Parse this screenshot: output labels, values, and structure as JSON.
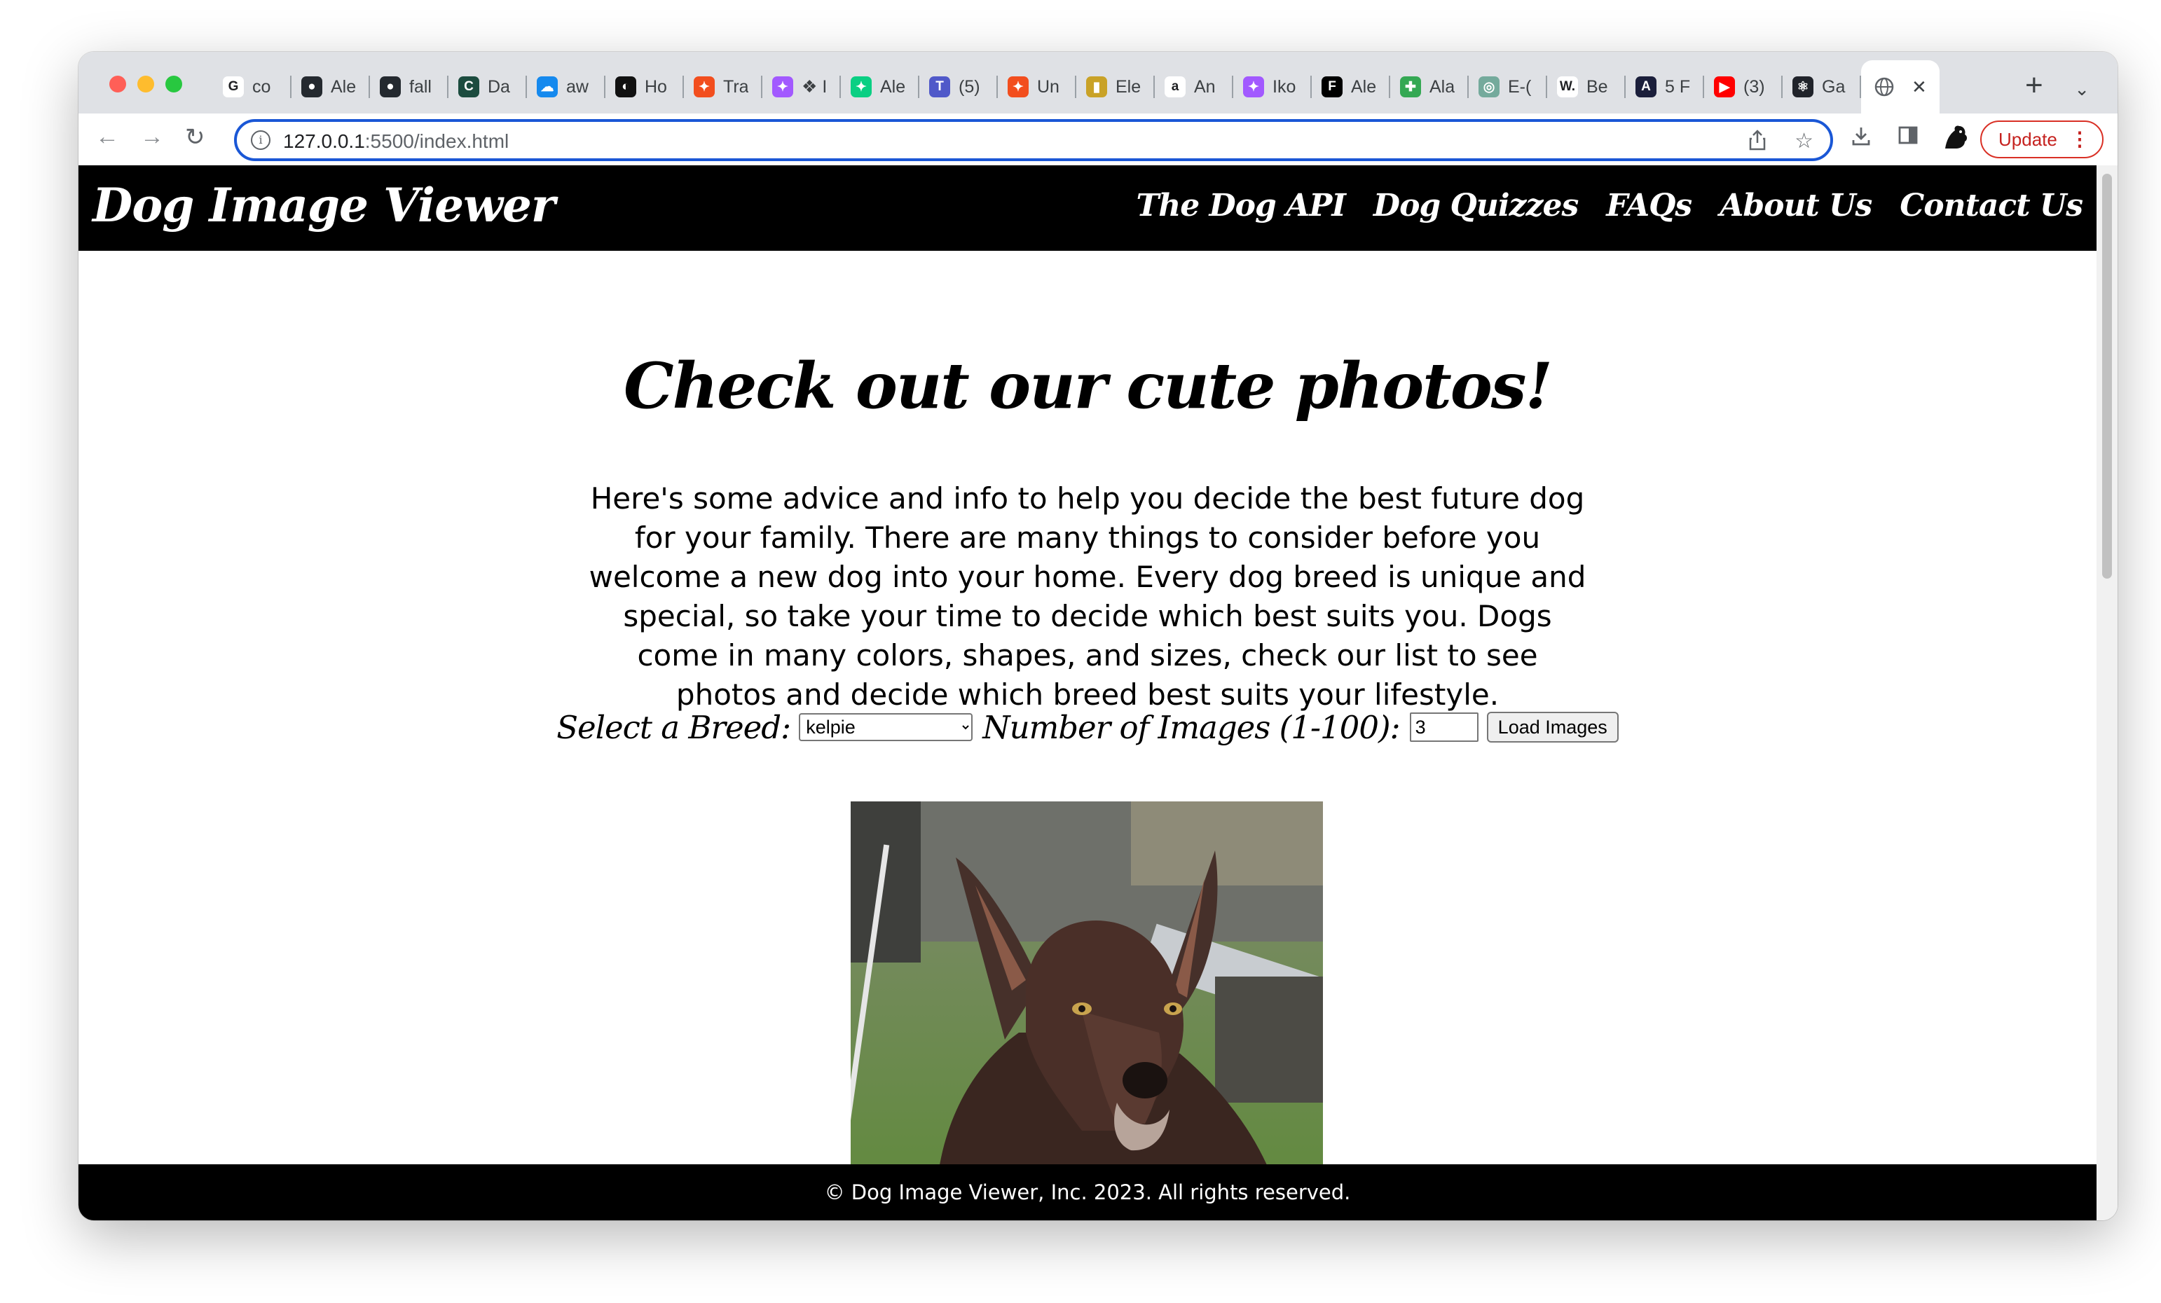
{
  "browser": {
    "tabs": [
      {
        "title": "co",
        "icon": "google-icon",
        "color": "#ffffff"
      },
      {
        "title": "Ale",
        "icon": "github-icon",
        "color": "#24292f"
      },
      {
        "title": "fall",
        "icon": "github-icon",
        "color": "#24292f"
      },
      {
        "title": "Da",
        "icon": "codesignal-icon",
        "color": "#1c4c3f"
      },
      {
        "title": "aw",
        "icon": "salesforce-icon",
        "color": "#1589ee"
      },
      {
        "title": "Ho",
        "icon": "circle-logo-icon",
        "color": "#111111"
      },
      {
        "title": "Tra",
        "icon": "figma-icon",
        "color": "#f24e1e"
      },
      {
        "title": "❖ I",
        "icon": "figma-icon",
        "color": "#a259ff"
      },
      {
        "title": "Ale",
        "icon": "figma-icon",
        "color": "#0acf83"
      },
      {
        "title": "(5)",
        "icon": "teams-icon",
        "color": "#5059c9"
      },
      {
        "title": "Un",
        "icon": "figma-icon",
        "color": "#f24e1e"
      },
      {
        "title": "Ele",
        "icon": "shopping-bag-icon",
        "color": "#c9a227"
      },
      {
        "title": "An",
        "icon": "amazon-icon",
        "color": "#ffffff"
      },
      {
        "title": "Iko",
        "icon": "figma-icon",
        "color": "#a259ff"
      },
      {
        "title": "Ale",
        "icon": "framer-icon",
        "color": "#000000"
      },
      {
        "title": "Ala",
        "icon": "colorful-logo-icon",
        "color": "#34a853"
      },
      {
        "title": "E-(",
        "icon": "chatgpt-icon",
        "color": "#74aa9c"
      },
      {
        "title": "Be",
        "icon": "wix-icon",
        "color": "#ffffff"
      },
      {
        "title": "5 F",
        "icon": "apollo-icon",
        "color": "#1b1f3b"
      },
      {
        "title": "(3)",
        "icon": "youtube-icon",
        "color": "#ff0000"
      },
      {
        "title": "Ga",
        "icon": "react-icon",
        "color": "#20232a"
      }
    ],
    "active_tab_icon": "globe-icon",
    "url_host": "127.0.0.1",
    "url_rest": ":5500/index.html",
    "update_label": "Update"
  },
  "site": {
    "logo": "Dog Image Viewer",
    "nav": [
      "The Dog API",
      "Dog Quizzes",
      "FAQs",
      "About Us",
      "Contact Us"
    ],
    "heading": "Check out our cute photos!",
    "intro": "Here's some advice and info to help you decide the best future dog for your family. There are many things to consider before you welcome a new dog into your home. Every dog breed is unique and special, so take your time to decide which best suits you. Dogs come in many colors, shapes, and sizes, check our list to see photos and decide which breed best suits your lifestyle.",
    "breed_label": "Select a Breed:",
    "breed_value": "kelpie",
    "count_label": "Number of Images (1-100):",
    "count_value": "3",
    "load_button": "Load Images",
    "footer": "© Dog Image Viewer, Inc. 2023. All rights reserved."
  }
}
